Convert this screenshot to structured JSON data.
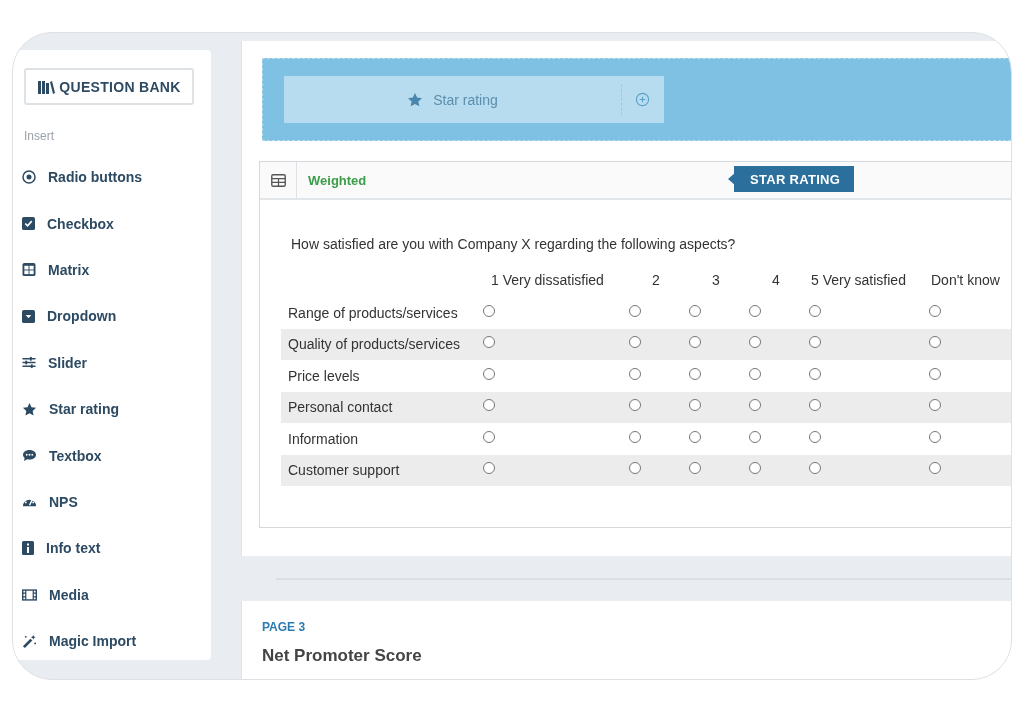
{
  "sidebar": {
    "question_bank_button": "QUESTION BANK",
    "section_label": "Insert",
    "items": [
      {
        "label": "Radio buttons",
        "kind": "radio"
      },
      {
        "label": "Checkbox",
        "kind": "checkbox"
      },
      {
        "label": "Matrix",
        "kind": "matrix"
      },
      {
        "label": "Dropdown",
        "kind": "dropdown"
      },
      {
        "label": "Slider",
        "kind": "slider"
      },
      {
        "label": "Star rating",
        "kind": "star"
      },
      {
        "label": "Textbox",
        "kind": "textbox"
      },
      {
        "label": "NPS",
        "kind": "gauge"
      },
      {
        "label": "Info text",
        "kind": "info"
      },
      {
        "label": "Media",
        "kind": "film"
      },
      {
        "label": "Magic Import",
        "kind": "wand"
      }
    ]
  },
  "drop_zone": {
    "chip_label": "Star rating"
  },
  "question": {
    "mode": "Weighted",
    "type_tag": "STAR RATING",
    "text": "How satisfied are you with Company X regarding the following aspects?",
    "columns": [
      "1 Very dissatisfied",
      "2",
      "3",
      "4",
      "5 Very satisfied",
      "Don't know"
    ],
    "rows": [
      {
        "label": "Range of products/services",
        "answers": [
          {
            "selected": false
          },
          {
            "selected": false
          },
          {
            "selected": false
          },
          {
            "selected": false
          },
          {
            "selected": false
          },
          {
            "selected": false
          }
        ]
      },
      {
        "label": "Quality of products/services",
        "answers": [
          {
            "selected": false
          },
          {
            "selected": false
          },
          {
            "selected": false
          },
          {
            "selected": false
          },
          {
            "selected": false
          },
          {
            "selected": false
          }
        ]
      },
      {
        "label": "Price levels",
        "answers": [
          {
            "selected": false
          },
          {
            "selected": false
          },
          {
            "selected": false
          },
          {
            "selected": false
          },
          {
            "selected": false
          },
          {
            "selected": false
          }
        ]
      },
      {
        "label": "Personal contact",
        "answers": [
          {
            "selected": false
          },
          {
            "selected": false
          },
          {
            "selected": false
          },
          {
            "selected": false
          },
          {
            "selected": false
          },
          {
            "selected": false
          }
        ]
      },
      {
        "label": "Information",
        "answers": [
          {
            "selected": false
          },
          {
            "selected": false
          },
          {
            "selected": false
          },
          {
            "selected": false
          },
          {
            "selected": false
          },
          {
            "selected": false
          }
        ]
      },
      {
        "label": "Customer support",
        "answers": [
          {
            "selected": false
          },
          {
            "selected": false
          },
          {
            "selected": false
          },
          {
            "selected": false
          },
          {
            "selected": false
          },
          {
            "selected": false
          }
        ]
      }
    ]
  },
  "next_page": {
    "label": "PAGE 3",
    "title": "Net Promoter Score"
  }
}
